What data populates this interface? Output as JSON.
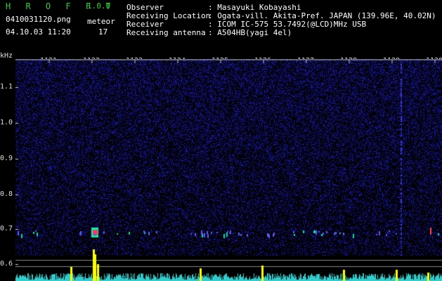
{
  "header": {
    "app_name": "H R O F F T",
    "version": "1.0.0",
    "filename": "0410031120.png",
    "datetime": "04.10.03 11:20",
    "meteor_label": "meteor",
    "meteor_count": "17"
  },
  "info": [
    {
      "label": "Observer",
      "value": ": Masayuki Kobayashi"
    },
    {
      "label": "Receiving Location",
      "value": ": Ogata-vill. Akita-Pref. JAPAN (139.96E, 40.02N)"
    },
    {
      "label": "Receiver",
      "value": ": ICOM IC-575 53.7492(@LCD)MHz USB"
    },
    {
      "label": "Receiving antenna",
      "value": ": A504HB(yagi 4el)"
    }
  ],
  "axis": {
    "unit": "kHz",
    "freq_ticks": [
      "1.1",
      "1.0",
      "0.9",
      "0.8",
      "0.7",
      "0.6"
    ],
    "time_ticks": [
      "1121",
      "1122",
      "1123",
      "1124",
      "1125",
      "1126",
      "1127",
      "1128",
      "1129",
      "1130"
    ]
  },
  "colors": {
    "background": "#000000",
    "noise": "#1b1bb0",
    "meteor_hot": "#ff3366",
    "meteor_mid": "#00ff99",
    "histogram": "#ffff00",
    "hist_base": "#33cccc"
  }
}
